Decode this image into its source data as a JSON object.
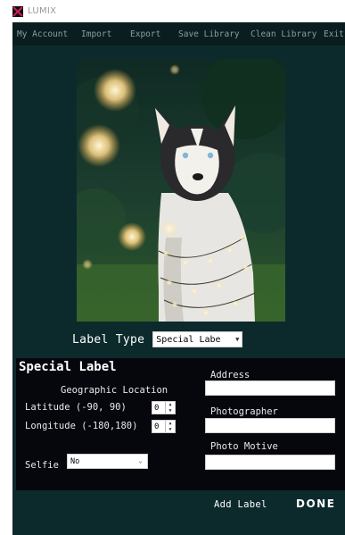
{
  "app": {
    "title": "LUMIX"
  },
  "menu": [
    {
      "label": "My Account"
    },
    {
      "label": "Import"
    },
    {
      "label": "Export"
    },
    {
      "label": "Save Library"
    },
    {
      "label": "Clean Library"
    },
    {
      "label": "Exit"
    }
  ],
  "label_type": {
    "label": "Label Type",
    "selected": "Special Labe"
  },
  "special_label": {
    "title": "Special Label",
    "geo_title": "Geographic Location",
    "latitude": {
      "label": "Latitude (-90, 90)",
      "value": "0"
    },
    "longitude": {
      "label": "Longitude (-180,180)",
      "value": "0"
    },
    "selfie": {
      "label": "Selfie",
      "selected": "No"
    },
    "address": {
      "label": "Address",
      "value": ""
    },
    "photographer": {
      "label": "Photographer",
      "value": ""
    },
    "photo_motive": {
      "label": "Photo Motive",
      "value": ""
    }
  },
  "actions": {
    "add_label": "Add Label",
    "done": "DONE"
  },
  "colors": {
    "window_bg": "#0c2a2c",
    "menubar_bg": "#0a1e20",
    "panel_bg": "#05070d",
    "accent_icon": "#d81b60"
  },
  "photo": {
    "icon": "husky-with-lights-image"
  }
}
